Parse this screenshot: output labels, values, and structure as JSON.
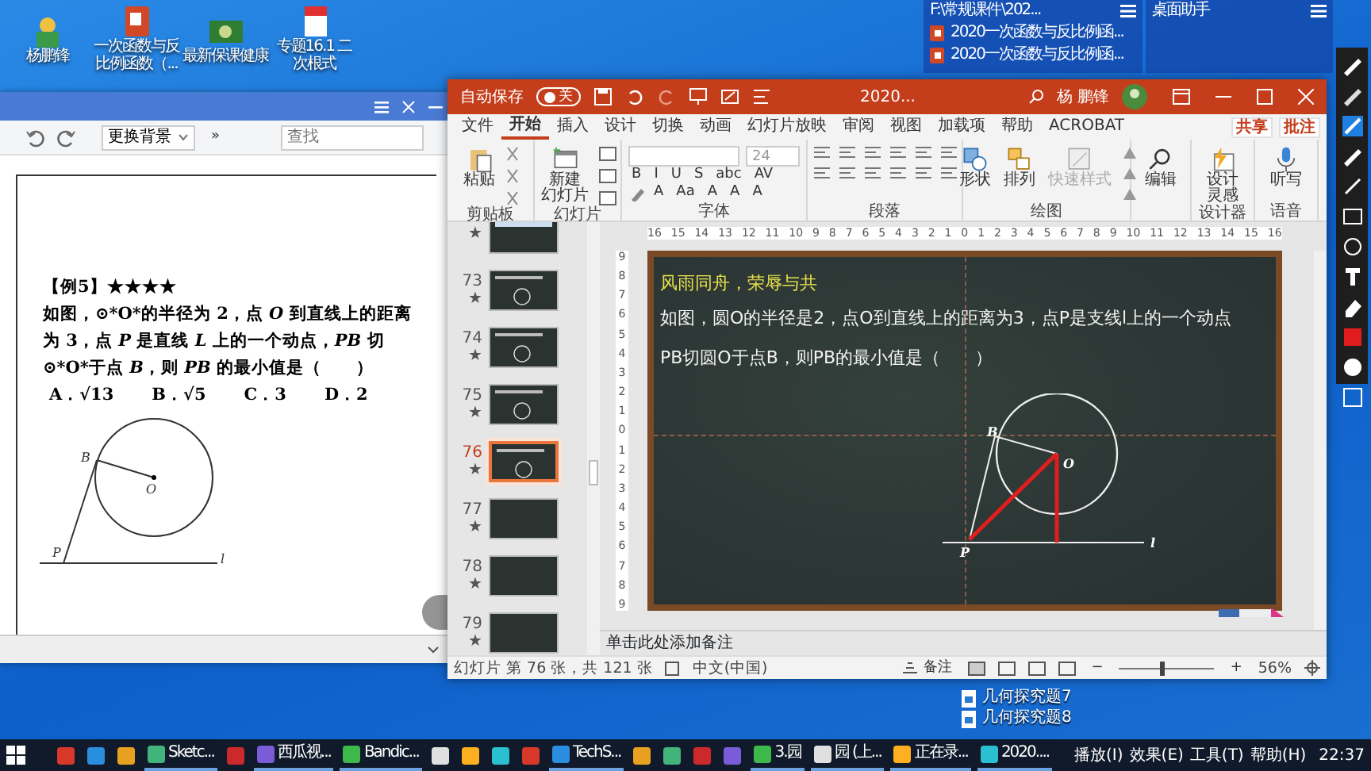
{
  "desktop_icons": [
    {
      "label": "杨鹏锋"
    },
    {
      "label": "一次函数与反比例函数（..."
    },
    {
      "label": "最新保课健康"
    },
    {
      "label": "专题16.1 二次根式"
    }
  ],
  "file_panel": {
    "path": "F:\\常规课件\\202...",
    "files": [
      "2020一次函数与反比例函...",
      "2020一次函数与反比例函..."
    ]
  },
  "assistant_panel": {
    "title": "桌面助手"
  },
  "doc_viewer": {
    "background_button": "更换背景",
    "more_button": "»",
    "search": {
      "placeholder": "查找"
    },
    "heading": "【例5】★★★★",
    "question": "如图，⊙*O*的半径为 2，点 *O* 到直线上的距离为 3，点 *P* 是直线 *L* 上的一个动点，*PB* 切⊙*O*于点 *B*，则 *PB* 的最小值是（　　）",
    "options": [
      "A．√13",
      "B．√5",
      "C．3",
      "D．2"
    ],
    "figure_labels": {
      "b": "B",
      "o": "O",
      "p": "P",
      "line": "l"
    }
  },
  "slides_window": {
    "autosave_label": "自动保存",
    "autosave": {
      "on": false,
      "text": "关"
    },
    "title": "2020...",
    "user": "杨 鹏锋",
    "menu": [
      {
        "label": "文件",
        "selected": false
      },
      {
        "label": "开始",
        "selected": true
      },
      {
        "label": "插入",
        "selected": false
      },
      {
        "label": "设计",
        "selected": false
      },
      {
        "label": "切换",
        "selected": false
      },
      {
        "label": "动画",
        "selected": false
      },
      {
        "label": "幻灯片放映",
        "selected": false
      },
      {
        "label": "审阅",
        "selected": false
      },
      {
        "label": "视图",
        "selected": false
      },
      {
        "label": "加载项",
        "selected": false
      },
      {
        "label": "帮助",
        "selected": false
      },
      {
        "label": "ACROBAT",
        "selected": false
      }
    ],
    "share_button": "共享",
    "comments_button": "批注",
    "ribbon": [
      {
        "kind": "clipboard",
        "label": "剪贴板",
        "buttons": [
          {
            "lines": [
              "粘贴"
            ],
            "disabled": false
          }
        ]
      },
      {
        "kind": "slides",
        "label": "幻灯片",
        "buttons": [
          {
            "lines": [
              "新建",
              "幻灯片"
            ],
            "disabled": false
          }
        ]
      },
      {
        "kind": "font",
        "label": "字体",
        "font_size": "24",
        "row1": [
          "B",
          "I",
          "U",
          "S",
          "abc",
          "AV"
        ],
        "row2": [
          "A",
          "Aa",
          "A",
          "A",
          "A"
        ]
      },
      {
        "kind": "paragraph",
        "label": "段落"
      },
      {
        "kind": "drawing",
        "label": "绘图",
        "buttons": [
          {
            "lines": [
              "形状"
            ],
            "disabled": false
          },
          {
            "lines": [
              "排列"
            ],
            "disabled": false
          },
          {
            "lines": [
              "快速样式"
            ],
            "disabled": true
          }
        ]
      },
      {
        "kind": "editing",
        "buttons": [
          {
            "lines": [
              "编辑"
            ],
            "disabled": false
          }
        ]
      },
      {
        "kind": "designer",
        "label": "设计器",
        "buttons": [
          {
            "lines": [
              "设计",
              "灵感"
            ],
            "disabled": false
          }
        ]
      },
      {
        "kind": "voice",
        "label": "语音",
        "buttons": [
          {
            "lines": [
              "听写"
            ],
            "disabled": false
          }
        ]
      }
    ],
    "h_ruler": [
      "16",
      "15",
      "14",
      "13",
      "12",
      "11",
      "10",
      "9",
      "8",
      "7",
      "6",
      "5",
      "4",
      "3",
      "2",
      "1",
      "0",
      "1",
      "2",
      "3",
      "4",
      "5",
      "6",
      "7",
      "8",
      "9",
      "10",
      "11",
      "12",
      "13",
      "14",
      "15",
      "16"
    ],
    "v_ruler": [
      "9",
      "8",
      "7",
      "6",
      "5",
      "4",
      "3",
      "2",
      "1",
      "0",
      "1",
      "2",
      "3",
      "4",
      "5",
      "6",
      "7",
      "8",
      "9"
    ],
    "thumbnails": [
      {
        "mark": "★",
        "kind": "text",
        "selected": false
      },
      {
        "number": "73",
        "mark": "★",
        "kind": "diagram",
        "selected": false
      },
      {
        "number": "74",
        "mark": "★",
        "kind": "diagram",
        "selected": false
      },
      {
        "number": "75",
        "mark": "★",
        "kind": "diagram",
        "selected": false
      },
      {
        "number": "76",
        "mark": "★",
        "kind": "diagram",
        "selected": true
      },
      {
        "number": "77",
        "mark": "★",
        "kind": "blank",
        "selected": false
      },
      {
        "number": "78",
        "mark": "★",
        "kind": "blank",
        "selected": false
      },
      {
        "number": "79",
        "mark": "★",
        "kind": "blank",
        "selected": false
      }
    ],
    "slide": {
      "title": "风雨同舟，荣辱与共",
      "lines": [
        "如图，圆O的半径是2，点O到直线上的距离为3，点P是支线l上的一个动点",
        "PB切圆O于点B，则PB的最小值是（　　）"
      ],
      "figure_labels": {
        "b": "B",
        "o": "O",
        "p": "P",
        "line": "l"
      }
    },
    "notes_placeholder": "单击此处添加备注",
    "status": {
      "slide_info": "幻灯片 第 76 张，共 121 张",
      "language": "中文(中国)",
      "notes": "备注",
      "zoom_minus": "−",
      "zoom_plus": "+",
      "zoom": {
        "level": 0.45
      },
      "zoom_text": "56%"
    }
  },
  "desktop_files": [
    "几何探究题7",
    "几何探究题8"
  ],
  "taskbar": {
    "apps": [
      {
        "kind": "icon"
      },
      {
        "kind": "icon"
      },
      {
        "kind": "icon"
      },
      {
        "kind": "labeled",
        "label": "Sketc..."
      },
      {
        "kind": "icon"
      },
      {
        "kind": "labeled",
        "label": "西瓜视..."
      },
      {
        "kind": "labeled",
        "label": "Bandic..."
      },
      {
        "kind": "icon"
      },
      {
        "kind": "icon"
      },
      {
        "kind": "icon"
      },
      {
        "kind": "icon"
      },
      {
        "kind": "labeled",
        "label": "TechS..."
      },
      {
        "kind": "icon"
      },
      {
        "kind": "icon"
      },
      {
        "kind": "icon"
      },
      {
        "kind": "icon"
      },
      {
        "kind": "labeled",
        "label": "3.园"
      },
      {
        "kind": "labeled",
        "label": "园 (上..."
      },
      {
        "kind": "labeled",
        "label": "正在录..."
      },
      {
        "kind": "labeled",
        "label": "2020...."
      }
    ],
    "tray_menu": [
      "播放(I)",
      "效果(E)",
      "工具(T)",
      "帮助(H)"
    ],
    "time": "22:37"
  }
}
